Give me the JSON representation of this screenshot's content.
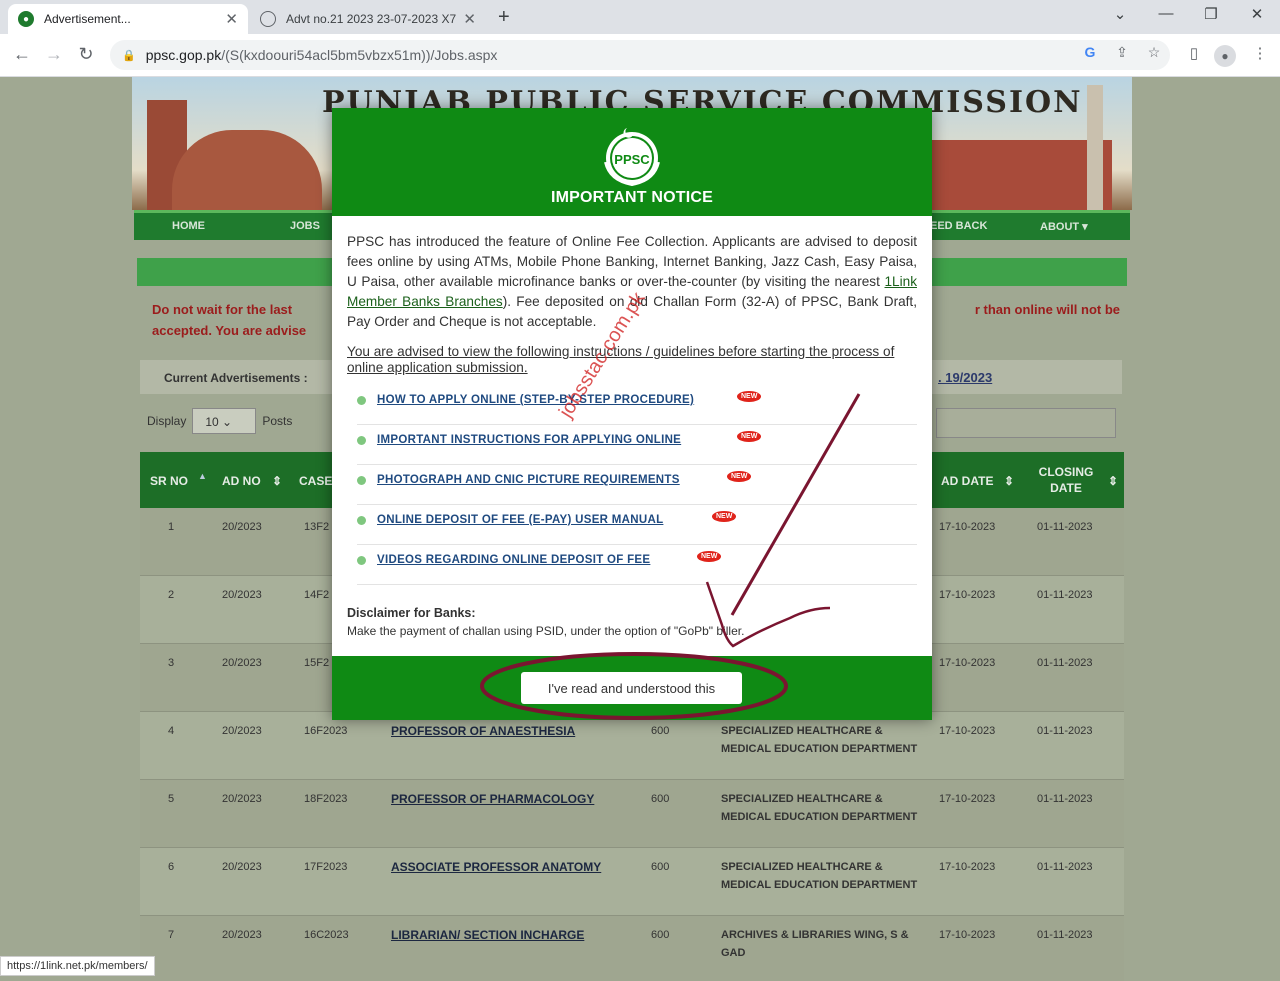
{
  "browser": {
    "tabs": [
      {
        "title": "Advertisement...",
        "active": true
      },
      {
        "title": "Advt no.21 2023 23-07-2023 X7",
        "active": false
      }
    ],
    "url_host": "ppsc.gop.pk",
    "url_path": "/(S(kxdoouri54acl5bm5vbzx51m))/Jobs.aspx",
    "status_url": "https://1link.net.pk/members/"
  },
  "site": {
    "banner_title": "PUNJAB PUBLIC SERVICE COMMISSION",
    "nav": [
      "HOME",
      "JOBS",
      "EED BACK",
      "ABOUT ▾"
    ],
    "warning_left_1": "Do not wait for the last",
    "warning_left_2": "accepted. You are advise",
    "warning_right": "r than online will not be",
    "current_label": "Current Advertisements :",
    "current_ad": ". 19/2023",
    "display_label": "Display",
    "display_value": "10",
    "posts_label": "Posts"
  },
  "table": {
    "headers": [
      "SR NO",
      "AD NO",
      "CASE",
      "AD DATE",
      "CLOSING DATE"
    ],
    "rows": [
      {
        "sr": "1",
        "ad": "20/2023",
        "case": "13F2",
        "title": "",
        "pay": "",
        "dept": "",
        "ad_date": "17-10-2023",
        "closing": "01-11-2023"
      },
      {
        "sr": "2",
        "ad": "20/2023",
        "case": "14F2",
        "title": "",
        "pay": "",
        "dept": "",
        "ad_date": "17-10-2023",
        "closing": "01-11-2023"
      },
      {
        "sr": "3",
        "ad": "20/2023",
        "case": "15F2",
        "title": "",
        "pay": "",
        "dept": "",
        "ad_date": "17-10-2023",
        "closing": "01-11-2023"
      },
      {
        "sr": "4",
        "ad": "20/2023",
        "case": "16F2023",
        "title": "PROFESSOR OF ANAESTHESIA",
        "pay": "600",
        "dept": "SPECIALIZED HEALTHCARE & MEDICAL EDUCATION DEPARTMENT",
        "ad_date": "17-10-2023",
        "closing": "01-11-2023"
      },
      {
        "sr": "5",
        "ad": "20/2023",
        "case": "18F2023",
        "title": "PROFESSOR OF PHARMACOLOGY",
        "pay": "600",
        "dept": "SPECIALIZED HEALTHCARE & MEDICAL EDUCATION DEPARTMENT",
        "ad_date": "17-10-2023",
        "closing": "01-11-2023"
      },
      {
        "sr": "6",
        "ad": "20/2023",
        "case": "17F2023",
        "title": "ASSOCIATE PROFESSOR ANATOMY",
        "pay": "600",
        "dept": "SPECIALIZED HEALTHCARE & MEDICAL EDUCATION DEPARTMENT",
        "ad_date": "17-10-2023",
        "closing": "01-11-2023"
      },
      {
        "sr": "7",
        "ad": "20/2023",
        "case": "16C2023",
        "title": "LIBRARIAN/ SECTION INCHARGE",
        "pay": "600",
        "dept": "ARCHIVES & LIBRARIES WING, S & GAD",
        "ad_date": "17-10-2023",
        "closing": "01-11-2023"
      }
    ]
  },
  "modal": {
    "logo_text": "PPSC",
    "title": "IMPORTANT NOTICE",
    "para_before_link": "PPSC has introduced the feature of Online Fee Collection. Applicants are advised to deposit fees online by using ATMs, Mobile Phone Banking, Internet Banking, Jazz Cash, Easy Paisa, U Paisa, other available microfinance banks or over-the-counter (by visiting the nearest ",
    "link_text": "1Link Member Banks Branches",
    "para_after_link": "). Fee deposited on old Challan Form (32-A) of PPSC, Bank Draft, Pay Order and Cheque is not acceptable.",
    "advised": "You are advised to view the following instructions / guidelines before starting the process of online application submission.",
    "links": [
      "HOW TO APPLY ONLINE (STEP-BY-STEP PROCEDURE)",
      "IMPORTANT INSTRUCTIONS FOR APPLYING ONLINE",
      "PHOTOGRAPH AND CNIC PICTURE REQUIREMENTS",
      "ONLINE DEPOSIT OF FEE (E-PAY) USER MANUAL",
      "VIDEOS REGARDING ONLINE DEPOSIT OF FEE"
    ],
    "new_badge": "NEW",
    "disclaimer_title": "Disclaimer for Banks:",
    "disclaimer_text": "Make the payment of challan using PSID, under the option of \"GoPb\" biller.",
    "button_label": "I've read and understood this"
  },
  "watermark": "jobsstac.com.pk",
  "colors": {
    "modal_green": "#0f8a14",
    "nav_green": "#1f7b2e",
    "annotation": "#7a1530"
  }
}
